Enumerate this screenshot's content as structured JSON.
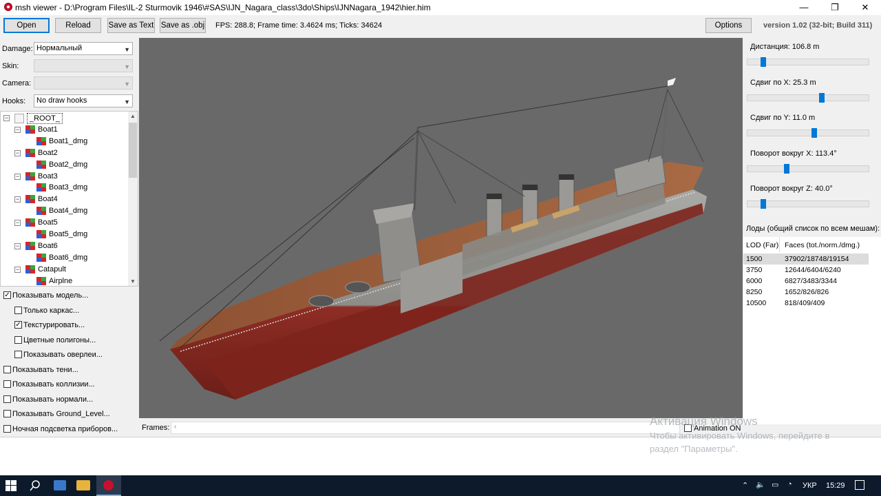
{
  "window": {
    "title": "msh viewer - D:\\Program Files\\IL-2 Sturmovik 1946\\#SAS\\IJN_Nagara_class\\3do\\Ships\\IJNNagara_1942\\hier.him",
    "minimize": "—",
    "maximize": "❐",
    "close": "✕"
  },
  "toolbar": {
    "open": "Open",
    "reload": "Reload",
    "save_text": "Save as Text",
    "save_obj": "Save as .obj",
    "stats": "FPS: 288.8; Frame time: 3.4624 ms; Ticks: 34624",
    "options": "Options",
    "version": "version 1.02 (32-bit; Build 311)"
  },
  "left": {
    "damage_label": "Damage:",
    "damage_value": "Нормальный",
    "skin_label": "Skin:",
    "skin_value": "",
    "camera_label": "Camera:",
    "camera_value": "",
    "hooks_label": "Hooks:",
    "hooks_value": "No draw hooks",
    "tree": [
      {
        "label": "_ROOT_",
        "level": 0
      },
      {
        "label": "Boat1",
        "level": 1
      },
      {
        "label": "Boat1_dmg",
        "level": 2
      },
      {
        "label": "Boat2",
        "level": 1
      },
      {
        "label": "Boat2_dmg",
        "level": 2
      },
      {
        "label": "Boat3",
        "level": 1
      },
      {
        "label": "Boat3_dmg",
        "level": 2
      },
      {
        "label": "Boat4",
        "level": 1
      },
      {
        "label": "Boat4_dmg",
        "level": 2
      },
      {
        "label": "Boat5",
        "level": 1
      },
      {
        "label": "Boat5_dmg",
        "level": 2
      },
      {
        "label": "Boat6",
        "level": 1
      },
      {
        "label": "Boat6_dmg",
        "level": 2
      },
      {
        "label": "Catapult",
        "level": 1
      },
      {
        "label": "Airplne",
        "level": 2
      }
    ],
    "checkboxes": [
      {
        "label": "Показывать модель...",
        "checked": true,
        "indent": 0
      },
      {
        "label": "Только каркас...",
        "checked": false,
        "indent": 1
      },
      {
        "label": "Текстурировать...",
        "checked": true,
        "indent": 1
      },
      {
        "label": "Цветные полигоны...",
        "checked": false,
        "indent": 1
      },
      {
        "label": "Показывать оверлеи...",
        "checked": false,
        "indent": 1
      },
      {
        "label": "Показывать тени...",
        "checked": false,
        "indent": 0
      },
      {
        "label": "Показывать коллизии...",
        "checked": false,
        "indent": 0
      },
      {
        "label": "Показывать нормали...",
        "checked": false,
        "indent": 0
      },
      {
        "label": "Показывать Ground_Level...",
        "checked": false,
        "indent": 0
      },
      {
        "label": "Ночная подсветка приборов...",
        "checked": false,
        "indent": 0
      }
    ]
  },
  "right": {
    "sliders": [
      {
        "label": "Дистанция:  106.8 m",
        "value": 0.12
      },
      {
        "label": "Сдвиг по X:  25.3 m",
        "value": 0.62
      },
      {
        "label": "Сдвиг по Y:  11.0 m",
        "value": 0.55
      },
      {
        "label": "Поворот вокруг X:  113.4°",
        "value": 0.32
      },
      {
        "label": "Поворот вокруг Z:  40.0°",
        "value": 0.12
      }
    ],
    "lod_title": "Лоды (общий список по всем мешам):",
    "lod_headers": [
      "LOD (Far)",
      "Faces (tot./norm./dmg.)"
    ],
    "lod_rows": [
      [
        "1500",
        "37902/18748/19154"
      ],
      [
        "3750",
        "12644/6404/6240"
      ],
      [
        "6000",
        "6827/3483/3344"
      ],
      [
        "8250",
        "1652/826/826"
      ],
      [
        "10500",
        "818/409/409"
      ]
    ]
  },
  "frames": {
    "label": "Frames:",
    "animation": "Animation ON"
  },
  "watermark": {
    "line1": "Активация Windows",
    "line2": "Чтобы активировать Windows, перейдите в",
    "line3": "раздел \"Параметры\"."
  },
  "taskbar": {
    "lang": "УКР",
    "time": "15:29"
  },
  "colors": {
    "accent": "#0078d7",
    "viewport_bg": "#696969",
    "hull_red": "#8b2b22",
    "deck": "#9a5c3a",
    "taskbar": "#0c1a2c"
  }
}
